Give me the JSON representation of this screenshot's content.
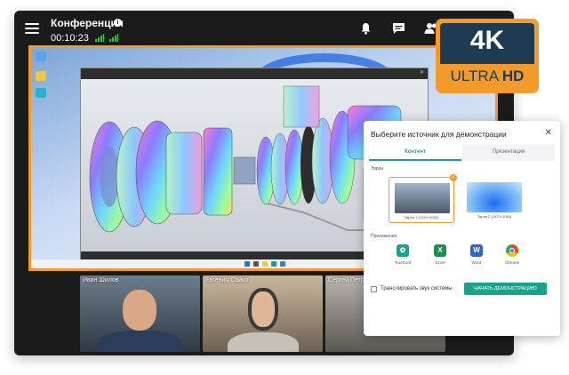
{
  "header": {
    "title": "Конференция",
    "timer": "00:10:23"
  },
  "participants": [
    {
      "name": "Иван Шилов"
    },
    {
      "name": "Евгения Сайко"
    },
    {
      "name": "Сергей Петро"
    }
  ],
  "badge": {
    "line1": "4K",
    "line2_a": "ULTRA ",
    "line2_b": "HD"
  },
  "dialog": {
    "title": "Выберите источник для демонстрации",
    "tabs": [
      "Контент",
      "Презентация"
    ],
    "screens_label": "Экран",
    "screens": [
      "Экран 1 (1920×1080)",
      "Экран 2 (1920×1080)"
    ],
    "apps_label": "Приложения",
    "apps": [
      "TrueConf",
      "Excel",
      "Word",
      "Chrome"
    ],
    "system_audio": "Транслировать звук системы",
    "start_button": "НАЧАТЬ ДЕМОНСТРАЦИЮ"
  },
  "colors": {
    "accent_orange": "#f39a2b",
    "accent_teal": "#1aa38a",
    "signal_green": "#3bc04a",
    "badge_navy": "#1e3b52"
  }
}
